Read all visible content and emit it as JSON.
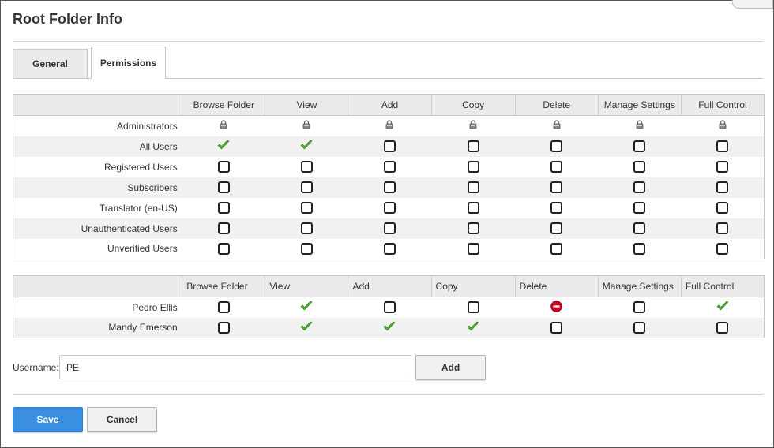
{
  "dialog": {
    "title": "Root Folder Info"
  },
  "tabs": [
    {
      "label": "General",
      "active": false
    },
    {
      "label": "Permissions",
      "active": true
    }
  ],
  "columns": [
    "Browse Folder",
    "View",
    "Add",
    "Copy",
    "Delete",
    "Manage Settings",
    "Full Control"
  ],
  "role_permissions": [
    {
      "role": "Administrators",
      "cells": [
        "locked",
        "locked",
        "locked",
        "locked",
        "locked",
        "locked",
        "locked"
      ]
    },
    {
      "role": "All Users",
      "cells": [
        "granted",
        "granted",
        "unchecked",
        "unchecked",
        "unchecked",
        "unchecked",
        "unchecked"
      ]
    },
    {
      "role": "Registered Users",
      "cells": [
        "unchecked",
        "unchecked",
        "unchecked",
        "unchecked",
        "unchecked",
        "unchecked",
        "unchecked"
      ]
    },
    {
      "role": "Subscribers",
      "cells": [
        "unchecked",
        "unchecked",
        "unchecked",
        "unchecked",
        "unchecked",
        "unchecked",
        "unchecked"
      ]
    },
    {
      "role": "Translator (en-US)",
      "cells": [
        "unchecked",
        "unchecked",
        "unchecked",
        "unchecked",
        "unchecked",
        "unchecked",
        "unchecked"
      ]
    },
    {
      "role": "Unauthenticated Users",
      "cells": [
        "unchecked",
        "unchecked",
        "unchecked",
        "unchecked",
        "unchecked",
        "unchecked",
        "unchecked"
      ]
    },
    {
      "role": "Unverified Users",
      "cells": [
        "unchecked",
        "unchecked",
        "unchecked",
        "unchecked",
        "unchecked",
        "unchecked",
        "unchecked"
      ]
    }
  ],
  "user_permissions": [
    {
      "user": "Pedro Ellis",
      "cells": [
        "unchecked",
        "granted",
        "unchecked",
        "unchecked",
        "denied",
        "unchecked",
        "granted"
      ]
    },
    {
      "user": "Mandy Emerson",
      "cells": [
        "unchecked",
        "granted",
        "granted",
        "granted",
        "unchecked",
        "unchecked",
        "unchecked"
      ]
    }
  ],
  "username_field": {
    "label": "Username:",
    "value": "PE"
  },
  "buttons": {
    "add": "Add",
    "save": "Save",
    "cancel": "Cancel"
  },
  "icons": {
    "locked": "lock-icon",
    "granted": "checkmark-icon",
    "denied": "deny-icon",
    "unchecked": "checkbox"
  },
  "colors": {
    "primary": "#3b8fe0",
    "granted": "#4caf2a",
    "denied": "#d0021b"
  }
}
